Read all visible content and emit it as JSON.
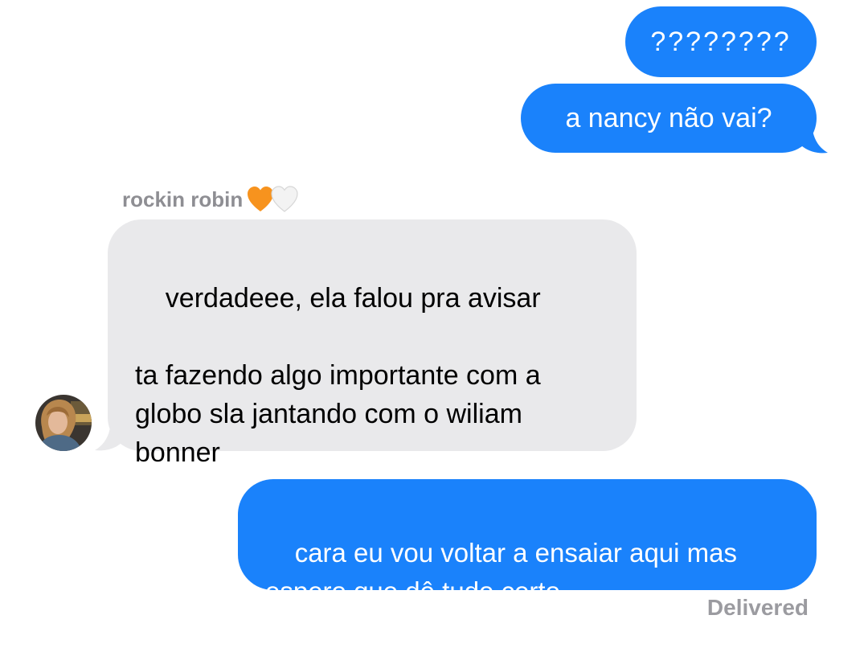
{
  "colors": {
    "outgoing_bubble": "#1a82fb",
    "incoming_bubble": "#e9e9eb",
    "meta_text": "#8e8e93",
    "heart_orange": "#f7931e",
    "heart_white": "#f0f0f0"
  },
  "messages": [
    {
      "direction": "outgoing",
      "text": "????????"
    },
    {
      "direction": "outgoing",
      "text": "a nancy não vai?"
    },
    {
      "direction": "incoming",
      "text": "verdadeee, ela falou pra avisar\n\nta fazendo algo importante com a\nglobo sla jantando com o wiliam\nbonner"
    },
    {
      "direction": "outgoing",
      "text": "cara eu vou voltar a ensaiar aqui mas\nespero que dê tudo certo..."
    }
  ],
  "sender": {
    "name": "rockin robin",
    "icons": [
      "orange-heart-icon",
      "white-heart-icon"
    ]
  },
  "status": "Delivered"
}
